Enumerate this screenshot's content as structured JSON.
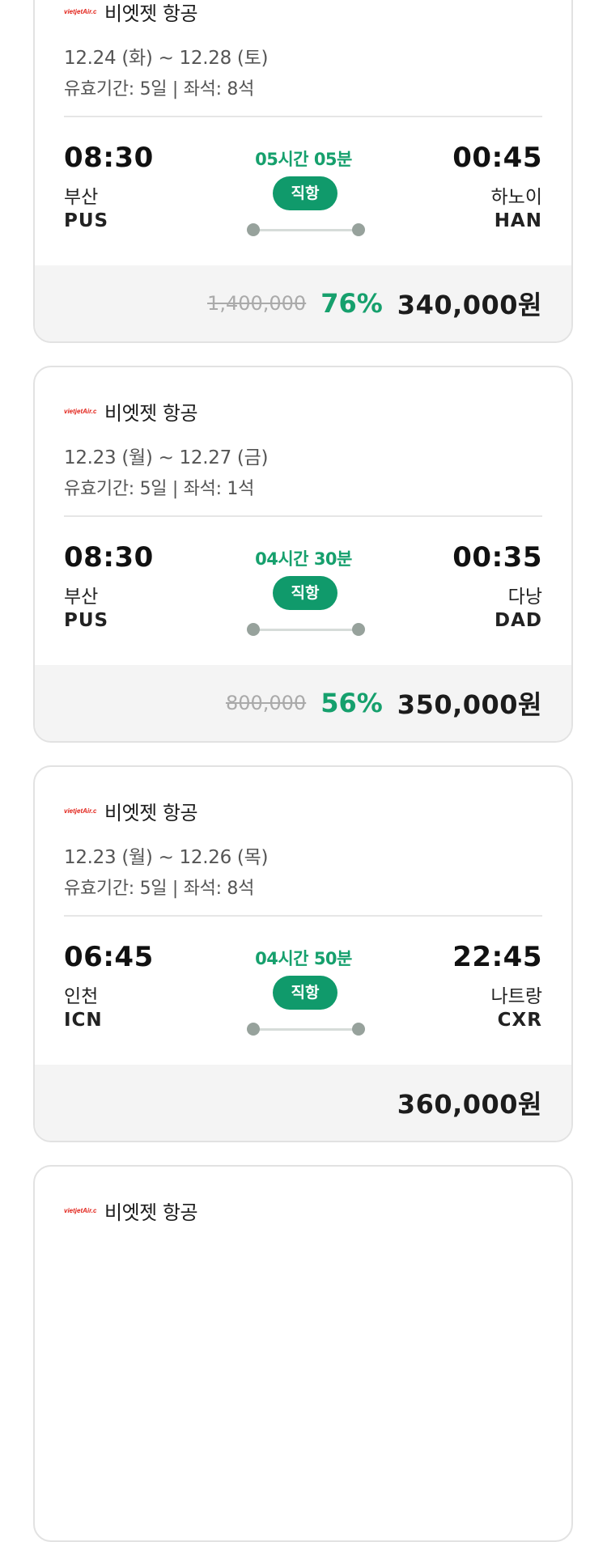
{
  "cards": [
    {
      "airline": "비엣젯 항공",
      "logo_text": "vietjetAir.com",
      "dates": "12.24 (화) ~ 12.28 (토)",
      "validity": "유효기간: 5일 | 좌석: 8석",
      "dep_time": "08:30",
      "dep_city": "부산",
      "dep_code": "PUS",
      "arr_time": "00:45",
      "arr_city": "하노이",
      "arr_code": "HAN",
      "duration": "05시간 05분",
      "direct_label": "직항",
      "original_price": "1,400,000",
      "discount": "76%",
      "price": "340,000원"
    },
    {
      "airline": "비엣젯 항공",
      "logo_text": "vietjetAir.com",
      "dates": "12.23 (월) ~ 12.27 (금)",
      "validity": "유효기간: 5일 | 좌석: 1석",
      "dep_time": "08:30",
      "dep_city": "부산",
      "dep_code": "PUS",
      "arr_time": "00:35",
      "arr_city": "다낭",
      "arr_code": "DAD",
      "duration": "04시간 30분",
      "direct_label": "직항",
      "original_price": "800,000",
      "discount": "56%",
      "price": "350,000원"
    },
    {
      "airline": "비엣젯 항공",
      "logo_text": "vietjetAir.com",
      "dates": "12.23 (월) ~ 12.26 (목)",
      "validity": "유효기간: 5일 | 좌석: 8석",
      "dep_time": "06:45",
      "dep_city": "인천",
      "dep_code": "ICN",
      "arr_time": "22:45",
      "arr_city": "나트랑",
      "arr_code": "CXR",
      "duration": "04시간 50분",
      "direct_label": "직항",
      "price": "360,000원"
    },
    {
      "airline": "비엣젯 항공",
      "logo_text": "vietjetAir.com"
    }
  ],
  "colors": {
    "accent_green": "#16a06d",
    "badge_green": "#109a6b",
    "logo_red": "#e2231a"
  },
  "icons": {
    "airline_logo": "vietjet-logo-icon",
    "route_dot": "route-dot-icon"
  }
}
